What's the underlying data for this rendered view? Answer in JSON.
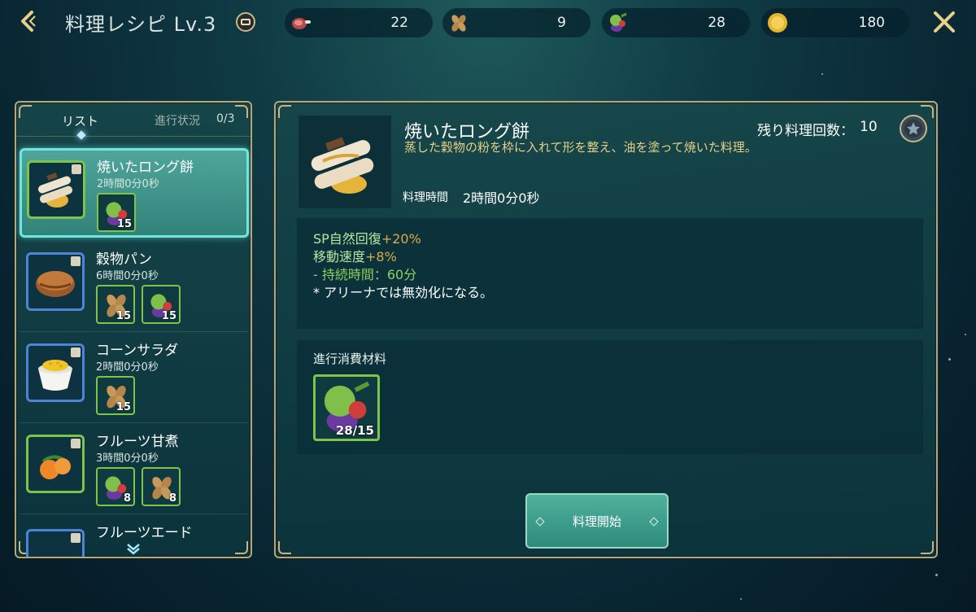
{
  "header": {
    "title": "料理レシピ Lv.3",
    "resources": [
      {
        "icon": "meat-icon",
        "value": "22"
      },
      {
        "icon": "grain-icon",
        "value": "9"
      },
      {
        "icon": "vegetable-icon",
        "value": "28"
      },
      {
        "icon": "gold-coin-icon",
        "value": "180"
      }
    ]
  },
  "list": {
    "tab_label": "リスト",
    "progress_label": "進行状況",
    "progress_value": "0/3",
    "items": [
      {
        "name": "焼いたロング餅",
        "time": "2時間0分0秒",
        "icon": "grilled-rice-cake-icon",
        "ingredients": [
          {
            "icon": "vegetable-icon",
            "count": "15"
          }
        ]
      },
      {
        "name": "穀物パン",
        "time": "6時間0分0秒",
        "icon": "grain-bread-icon",
        "ingredients": [
          {
            "icon": "grain-icon",
            "count": "15"
          },
          {
            "icon": "vegetable-icon",
            "count": "15"
          }
        ]
      },
      {
        "name": "コーンサラダ",
        "time": "2時間0分0秒",
        "icon": "corn-salad-icon",
        "ingredients": [
          {
            "icon": "grain-icon",
            "count": "15"
          }
        ]
      },
      {
        "name": "フルーツ甘煮",
        "time": "3時間0分0秒",
        "icon": "fruit-compote-icon",
        "ingredients": [
          {
            "icon": "vegetable-icon",
            "count": "8"
          },
          {
            "icon": "grain-icon",
            "count": "8"
          }
        ]
      },
      {
        "name": "フルーツエード",
        "time": "",
        "icon": "fruit-ade-icon",
        "ingredients": []
      }
    ]
  },
  "detail": {
    "name": "焼いたロング餅",
    "description": "蒸した穀物の粉を枠に入れて形を整え、油を塗って焼いた料理。",
    "time_label": "料理時間",
    "time_value": "2時間0分0秒",
    "remaining_label": "残り料理回数：",
    "remaining_value": "10",
    "effects": {
      "line1_label": "SP自然回復",
      "line1_value": "+20%",
      "line2_label": "移動速度",
      "line2_value": "+8%",
      "line3": "- 持続時間：60分",
      "line4": "* アリーナでは無効化になる。"
    },
    "materials_title": "進行消費材料",
    "materials": [
      {
        "icon": "vegetable-icon",
        "count": "28/15"
      }
    ],
    "cook_button": "料理開始"
  },
  "colors": {
    "accent_teal": "#6fe6df",
    "frame_gold": "#b9a576",
    "rarity_green": "#7ec34a",
    "rarity_blue": "#4d84d8",
    "desc_gold": "#e6cf86"
  }
}
